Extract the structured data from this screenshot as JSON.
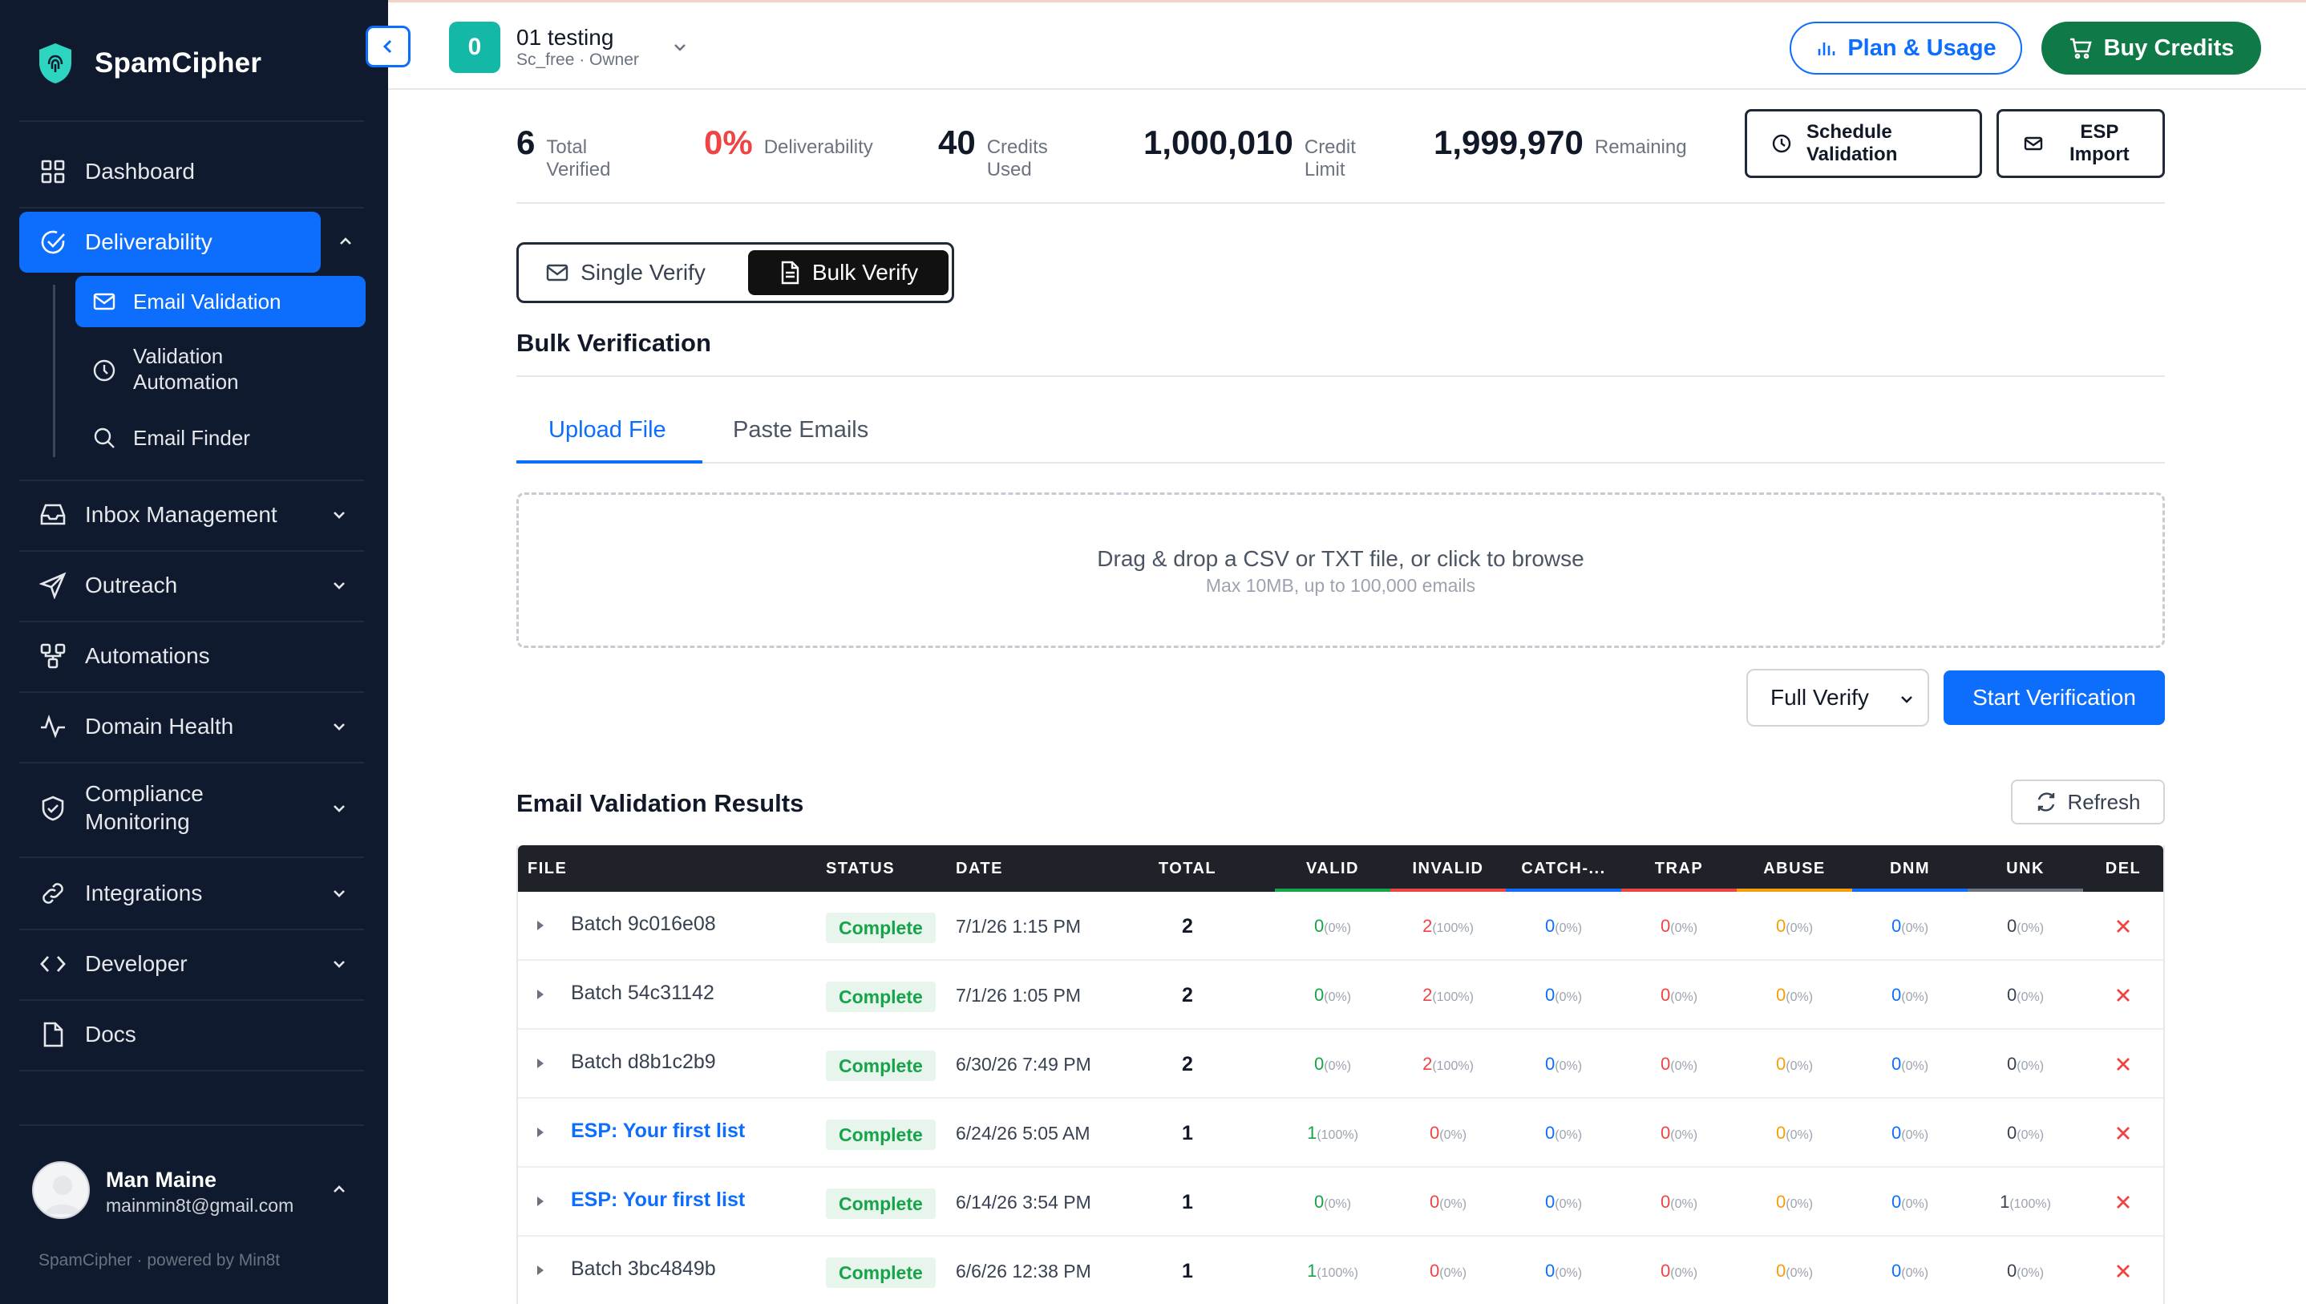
{
  "app": {
    "brand": "SpamCipher",
    "powered_by": "SpamCipher · powered by Min8t"
  },
  "sidebar": {
    "items": [
      {
        "label": "Dashboard"
      },
      {
        "label": "Deliverability"
      },
      {
        "label": "Inbox Management"
      },
      {
        "label": "Outreach"
      },
      {
        "label": "Automations"
      },
      {
        "label": "Domain Health"
      },
      {
        "label": "Compliance Monitoring"
      },
      {
        "label": "Integrations"
      },
      {
        "label": "Developer"
      },
      {
        "label": "Docs"
      }
    ],
    "sub_items": [
      {
        "label": "Email Validation"
      },
      {
        "label": "Validation Automation"
      },
      {
        "label": "Email Finder"
      }
    ],
    "compliance_line1": "Compliance",
    "compliance_line2": "Monitoring",
    "validation_line1": "Validation",
    "validation_line2": "Automation"
  },
  "user": {
    "name": "Man Maine",
    "email": "mainmin8t@gmail.com"
  },
  "topbar": {
    "workspace_badge": "0",
    "workspace_name": "01 testing",
    "workspace_sub": "Sc_free · Owner",
    "plan_label": "Plan & Usage",
    "buy_label": "Buy Credits"
  },
  "stats": {
    "total_verified_value": "6",
    "total_verified_l1": "Total",
    "total_verified_l2": "Verified",
    "deliverability_value": "0%",
    "deliverability_label": "Deliverability",
    "credits_used_value": "40",
    "credits_used_l1": "Credits",
    "credits_used_l2": "Used",
    "credit_limit_value": "1,000,010",
    "credit_limit_l1": "Credit",
    "credit_limit_l2": "Limit",
    "remaining_value": "1,999,970",
    "remaining_label": "Remaining",
    "schedule_l1": "Schedule",
    "schedule_l2": "Validation",
    "esp_l1": "ESP",
    "esp_l2": "Import"
  },
  "verify": {
    "single_label": "Single Verify",
    "bulk_label": "Bulk Verify",
    "section_title": "Bulk Verification",
    "tab_upload": "Upload File",
    "tab_paste": "Paste Emails",
    "drop_main": "Drag & drop a CSV or TXT file, or click to browse",
    "drop_sub": "Max 10MB, up to 100,000 emails",
    "mode_selected": "Full Verify",
    "start_label": "Start Verification"
  },
  "results": {
    "title": "Email Validation Results",
    "refresh_label": "Refresh",
    "columns": [
      "FILE",
      "STATUS",
      "DATE",
      "TOTAL",
      "VALID",
      "INVALID",
      "CATCH-...",
      "TRAP",
      "ABUSE",
      "DNM",
      "UNK",
      "DEL"
    ],
    "column_colors": {
      "valid": "#16a34a",
      "invalid": "#ef4444",
      "catch": "#0d6efd",
      "trap": "#ef4444",
      "abuse": "#f59e0b",
      "dnm": "#0d6efd",
      "unk": "#6b7280"
    },
    "rows": [
      {
        "file": "Batch 9c016e08",
        "link": false,
        "status": "Complete",
        "date": "7/1/26 1:15 PM",
        "total": "2",
        "valid": [
          "0",
          "(0%)"
        ],
        "invalid": [
          "2",
          "(100%)"
        ],
        "catch": [
          "0",
          "(0%)"
        ],
        "trap": [
          "0",
          "(0%)"
        ],
        "abuse": [
          "0",
          "(0%)"
        ],
        "dnm": [
          "0",
          "(0%)"
        ],
        "unk": [
          "0",
          "(0%)"
        ]
      },
      {
        "file": "Batch 54c31142",
        "link": false,
        "status": "Complete",
        "date": "7/1/26 1:05 PM",
        "total": "2",
        "valid": [
          "0",
          "(0%)"
        ],
        "invalid": [
          "2",
          "(100%)"
        ],
        "catch": [
          "0",
          "(0%)"
        ],
        "trap": [
          "0",
          "(0%)"
        ],
        "abuse": [
          "0",
          "(0%)"
        ],
        "dnm": [
          "0",
          "(0%)"
        ],
        "unk": [
          "0",
          "(0%)"
        ]
      },
      {
        "file": "Batch d8b1c2b9",
        "link": false,
        "status": "Complete",
        "date": "6/30/26 7:49 PM",
        "total": "2",
        "valid": [
          "0",
          "(0%)"
        ],
        "invalid": [
          "2",
          "(100%)"
        ],
        "catch": [
          "0",
          "(0%)"
        ],
        "trap": [
          "0",
          "(0%)"
        ],
        "abuse": [
          "0",
          "(0%)"
        ],
        "dnm": [
          "0",
          "(0%)"
        ],
        "unk": [
          "0",
          "(0%)"
        ]
      },
      {
        "file": "ESP: Your first list",
        "link": true,
        "status": "Complete",
        "date": "6/24/26 5:05 AM",
        "total": "1",
        "valid": [
          "1",
          "(100%)"
        ],
        "invalid": [
          "0",
          "(0%)"
        ],
        "catch": [
          "0",
          "(0%)"
        ],
        "trap": [
          "0",
          "(0%)"
        ],
        "abuse": [
          "0",
          "(0%)"
        ],
        "dnm": [
          "0",
          "(0%)"
        ],
        "unk": [
          "0",
          "(0%)"
        ]
      },
      {
        "file": "ESP: Your first list",
        "link": true,
        "status": "Complete",
        "date": "6/14/26 3:54 PM",
        "total": "1",
        "valid": [
          "0",
          "(0%)"
        ],
        "invalid": [
          "0",
          "(0%)"
        ],
        "catch": [
          "0",
          "(0%)"
        ],
        "trap": [
          "0",
          "(0%)"
        ],
        "abuse": [
          "0",
          "(0%)"
        ],
        "dnm": [
          "0",
          "(0%)"
        ],
        "unk": [
          "1",
          "(100%)"
        ]
      },
      {
        "file": "Batch 3bc4849b",
        "link": false,
        "status": "Complete",
        "date": "6/6/26 12:38 PM",
        "total": "1",
        "valid": [
          "1",
          "(100%)"
        ],
        "invalid": [
          "0",
          "(0%)"
        ],
        "catch": [
          "0",
          "(0%)"
        ],
        "trap": [
          "0",
          "(0%)"
        ],
        "abuse": [
          "0",
          "(0%)"
        ],
        "dnm": [
          "0",
          "(0%)"
        ],
        "unk": [
          "0",
          "(0%)"
        ]
      }
    ]
  },
  "colors": {
    "accent": "#0d6efd",
    "sidebar_bg": "#0f1a2e",
    "buy_green": "#0f7a47",
    "teal_badge": "#14b8a6",
    "status_green": "#16a34a",
    "danger": "#ef4444"
  }
}
